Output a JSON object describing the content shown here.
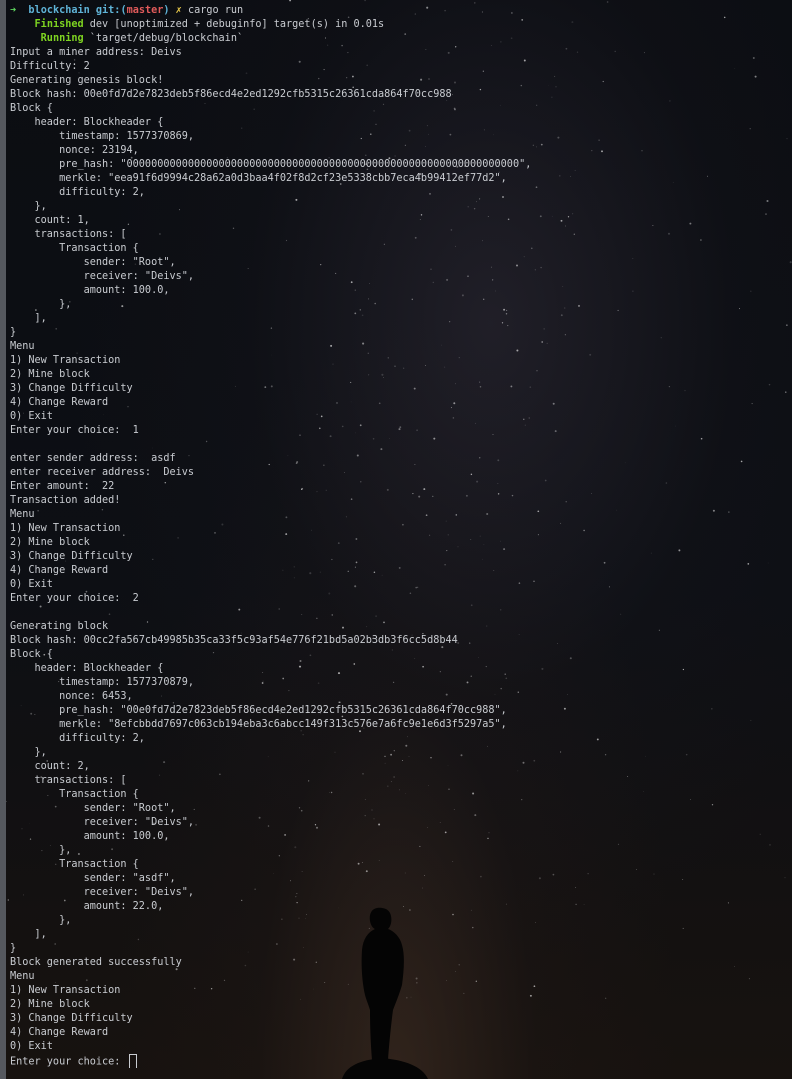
{
  "theme": {
    "prompt_arrow_color": "#5fd75f",
    "prompt_dir_color": "#5fb3d7",
    "prompt_branch_color": "#e05a5a",
    "prompt_x_color": "#e6c84a",
    "cargo_status_color": "#7ed321",
    "text_color": "#c9ccd1"
  },
  "prompt": {
    "arrow": "➜",
    "dir": "blockchain",
    "git": "git:(",
    "branch": "master",
    "git_close": ")",
    "dirty_mark": "✗",
    "command": "cargo run"
  },
  "cargo": {
    "finished_status": "Finished",
    "finished_text": "dev [unoptimized + debuginfo] target(s) in 0.01s",
    "running_status": "Running",
    "running_text": "`target/debug/blockchain`"
  },
  "output_lines": [
    "Input a miner address: Deivs",
    "Difficulty: 2",
    "Generating genesis block!",
    "Block hash: 00e0fd7d2e7823deb5f86ecd4e2ed1292cfb5315c26361cda864f70cc988",
    "Block {",
    "    header: Blockheader {",
    "        timestamp: 1577370869,",
    "        nonce: 23194,",
    "        pre_hash: \"0000000000000000000000000000000000000000000000000000000000000000\",",
    "        merkle: \"eea91f6d9994c28a62a0d3baa4f02f8d2cf23e5338cbb7eca4b99412ef77d2\",",
    "        difficulty: 2,",
    "    },",
    "    count: 1,",
    "    transactions: [",
    "        Transaction {",
    "            sender: \"Root\",",
    "            receiver: \"Deivs\",",
    "            amount: 100.0,",
    "        },",
    "    ],",
    "}",
    "Menu",
    "1) New Transaction",
    "2) Mine block",
    "3) Change Difficulty",
    "4) Change Reward",
    "0) Exit",
    "Enter your choice:  1",
    "",
    "enter sender address:  asdf",
    "enter receiver address:  Deivs",
    "Enter amount:  22",
    "Transaction added!",
    "Menu",
    "1) New Transaction",
    "2) Mine block",
    "3) Change Difficulty",
    "4) Change Reward",
    "0) Exit",
    "Enter your choice:  2",
    "",
    "Generating block",
    "Block hash: 00cc2fa567cb49985b35ca33f5c93af54e776f21bd5a02b3db3f6cc5d8b44",
    "Block {",
    "    header: Blockheader {",
    "        timestamp: 1577370879,",
    "        nonce: 6453,",
    "        pre_hash: \"00e0fd7d2e7823deb5f86ecd4e2ed1292cfb5315c26361cda864f70cc988\",",
    "        merkle: \"8efcbbdd7697c063cb194eba3c6abcc149f313c576e7a6fc9e1e6d3f5297a5\",",
    "        difficulty: 2,",
    "    },",
    "    count: 2,",
    "    transactions: [",
    "        Transaction {",
    "            sender: \"Root\",",
    "            receiver: \"Deivs\",",
    "            amount: 100.0,",
    "        },",
    "        Transaction {",
    "            sender: \"asdf\",",
    "            receiver: \"Deivs\",",
    "            amount: 22.0,",
    "        },",
    "    ],",
    "}",
    "Block generated successfully",
    "Menu",
    "1) New Transaction",
    "2) Mine block",
    "3) Change Difficulty",
    "4) Change Reward",
    "0) Exit"
  ],
  "input_prompt": "Enter your choice: "
}
